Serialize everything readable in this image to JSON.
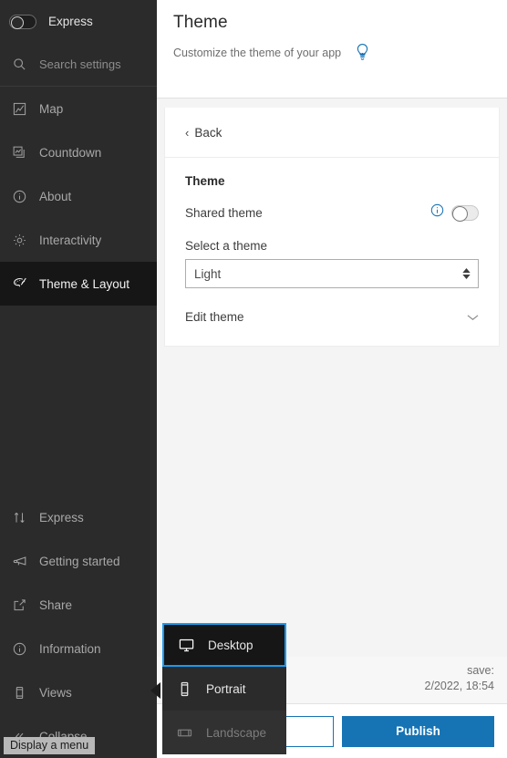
{
  "sidebar": {
    "express_toggle_label": "Express",
    "express_toggle_state": "off",
    "search_placeholder": "Search settings",
    "items": [
      {
        "label": "Map",
        "icon": "map-icon"
      },
      {
        "label": "Countdown",
        "icon": "countdown-icon"
      },
      {
        "label": "About",
        "icon": "info-circle-icon"
      },
      {
        "label": "Interactivity",
        "icon": "gear-icon"
      },
      {
        "label": "Theme & Layout",
        "icon": "palette-icon",
        "active": true
      }
    ],
    "bottom_items": [
      {
        "label": "Express",
        "icon": "arrows-updown-icon"
      },
      {
        "label": "Getting started",
        "icon": "megaphone-icon"
      },
      {
        "label": "Share",
        "icon": "share-icon"
      },
      {
        "label": "Information",
        "icon": "info-circle-icon"
      },
      {
        "label": "Views",
        "icon": "phone-icon"
      },
      {
        "label": "Collapse",
        "icon": "chevrons-left-icon"
      }
    ],
    "tooltip": "Display a menu"
  },
  "header": {
    "title": "Theme",
    "subtitle": "Customize the theme of your app",
    "hint_icon": "lightbulb-icon",
    "hint_icon_color": "#1673b4"
  },
  "panel": {
    "back_label": "Back",
    "section_title": "Theme",
    "shared_theme_label": "Shared theme",
    "shared_theme_state": "off",
    "shared_theme_info_icon": "info-circle-icon",
    "select_label": "Select a theme",
    "select_value": "Light",
    "select_options": [
      "Light"
    ],
    "edit_theme_label": "Edit theme",
    "edit_theme_chevron": "chevron-down-icon"
  },
  "savebar": {
    "line1": "save:",
    "line2": "2/2022, 18:54"
  },
  "actions": {
    "secondary_label": "",
    "primary_label": "Publish",
    "primary_color": "#1673b4"
  },
  "popup": {
    "items": [
      {
        "label": "Desktop",
        "icon": "monitor-icon",
        "state": "selected"
      },
      {
        "label": "Portrait",
        "icon": "phone-portrait-icon",
        "state": "normal"
      },
      {
        "label": "Landscape",
        "icon": "phone-landscape-icon",
        "state": "disabled"
      }
    ],
    "selection_color": "#1a9bf0"
  }
}
